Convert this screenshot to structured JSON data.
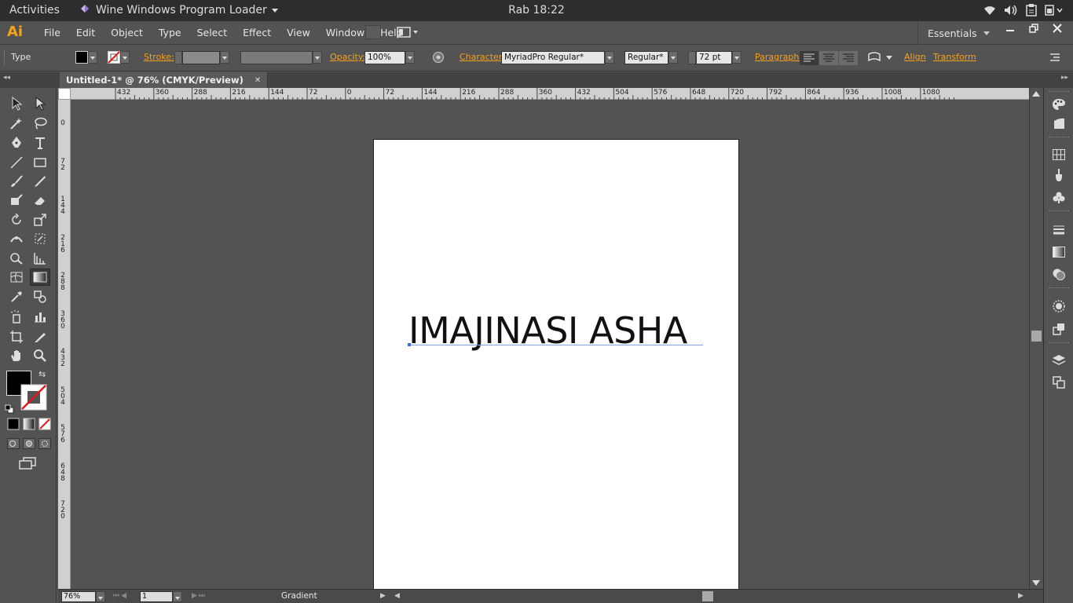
{
  "system_bar": {
    "activities": "Activities",
    "app_name": "Wine Windows Program Loader",
    "clock": "Rab 18:22",
    "tray_icons": [
      "wifi-icon",
      "volume-icon",
      "clipboard-icon",
      "power-icon"
    ]
  },
  "menubar": {
    "logo": "Ai",
    "items": [
      "File",
      "Edit",
      "Object",
      "Type",
      "Select",
      "Effect",
      "View",
      "Window",
      "Help"
    ],
    "workspace": "Essentials",
    "window_controls": [
      "minimize",
      "restore",
      "close"
    ]
  },
  "control_bar": {
    "tool_label": "Type",
    "stroke_label": "Stroke:",
    "opacity_label": "Opacity:",
    "opacity_value": "100%",
    "character_label": "Character:",
    "font_family": "MyriadPro Regular*",
    "font_style": "Regular*",
    "font_size": "72 pt",
    "paragraph_label": "Paragraph:",
    "align_label": "Align",
    "transform_label": "Transform",
    "fill_color": "#000000"
  },
  "document": {
    "tab_title": "Untitled-1* @ 76% (CMYK/Preview)",
    "artwork_text": "IMAJINASI ASHA"
  },
  "rulers": {
    "horizontal": [
      "432",
      "360",
      "288",
      "216",
      "144",
      "72",
      "0",
      "72",
      "144",
      "216",
      "288",
      "360",
      "432",
      "504",
      "576",
      "648",
      "720",
      "792",
      "864",
      "936",
      "1008",
      "1080"
    ],
    "vertical": [
      "0",
      "72",
      "144",
      "216",
      "288",
      "360",
      "432",
      "504",
      "576",
      "648",
      "720"
    ]
  },
  "status_bar": {
    "zoom": "76%",
    "page": "1",
    "info": "Gradient"
  },
  "colors": {
    "accent": "#f7a21b",
    "ui_bg": "#535353",
    "artboard": "#ffffff"
  }
}
